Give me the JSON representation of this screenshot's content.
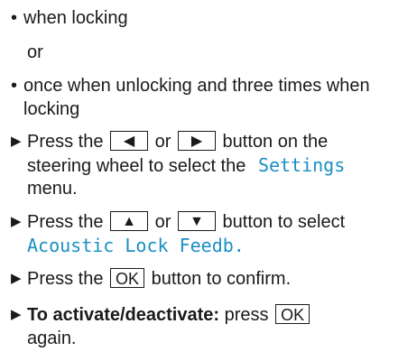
{
  "bullets": [
    {
      "text": "when locking"
    },
    {
      "text": "or"
    },
    {
      "line1": "once when unlocking and three times when",
      "line2": "locking"
    }
  ],
  "steps": [
    {
      "prefix": "Press the",
      "btn1": "◀",
      "mid": "or",
      "btn2": "▶",
      "suffix": "button on the",
      "line2_prefix": "steering wheel to select the",
      "line2_term": "Settings",
      "line3": "menu."
    },
    {
      "prefix": "Press the",
      "btn1": "▲",
      "mid": "or",
      "btn2": "▼",
      "suffix": "button to select",
      "line2_term": "Acoustic Lock Feedb."
    },
    {
      "prefix": "Press the",
      "btn": "OK",
      "suffix": "button to confirm."
    },
    {
      "bold": "To activate/deactivate:",
      "prefix": "press",
      "btn": "OK",
      "line2": "again."
    }
  ],
  "icons": {
    "bullet": "•",
    "step_arrow": "▶"
  }
}
